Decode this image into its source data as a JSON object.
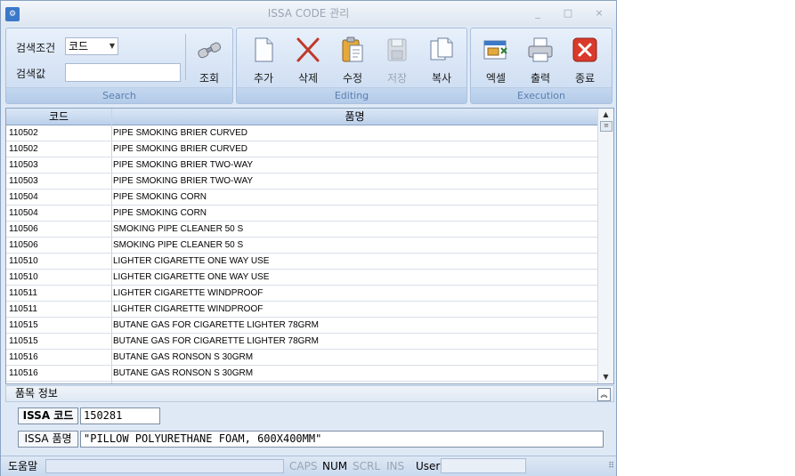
{
  "window": {
    "title": "ISSA CODE 관리",
    "minimize": "_",
    "maximize": "□",
    "close": "×"
  },
  "ribbon": {
    "search": {
      "group_label": "Search",
      "criteria_label": "검색조건",
      "criteria_value": "코드",
      "value_label": "검색값",
      "value_input": "",
      "query_label": "조회"
    },
    "editing": {
      "group_label": "Editing",
      "add_label": "추가",
      "delete_label": "삭제",
      "edit_label": "수정",
      "save_label": "저장",
      "copy_label": "복사"
    },
    "execution": {
      "group_label": "Execution",
      "excel_label": "엑셀",
      "print_label": "출력",
      "exit_label": "종료"
    }
  },
  "grid": {
    "columns": [
      "코드",
      "품명"
    ],
    "rows": [
      [
        "110502",
        "PIPE SMOKING BRIER CURVED"
      ],
      [
        "110502",
        "PIPE SMOKING BRIER CURVED"
      ],
      [
        "110503",
        "PIPE SMOKING BRIER TWO-WAY"
      ],
      [
        "110503",
        "PIPE SMOKING BRIER TWO-WAY"
      ],
      [
        "110504",
        "PIPE SMOKING CORN"
      ],
      [
        "110504",
        "PIPE SMOKING CORN"
      ],
      [
        "110506",
        "SMOKING PIPE CLEANER 50 S"
      ],
      [
        "110506",
        "SMOKING PIPE CLEANER 50 S"
      ],
      [
        "110510",
        "LIGHTER CIGARETTE ONE WAY USE"
      ],
      [
        "110510",
        "LIGHTER CIGARETTE ONE WAY USE"
      ],
      [
        "110511",
        "LIGHTER CIGARETTE WINDPROOF"
      ],
      [
        "110511",
        "LIGHTER CIGARETTE WINDPROOF"
      ],
      [
        "110515",
        "BUTANE GAS FOR CIGARETTE LIGHTER 78GRM"
      ],
      [
        "110515",
        "BUTANE GAS FOR CIGARETTE LIGHTER 78GRM"
      ],
      [
        "110516",
        "BUTANE GAS RONSON S 30GRM"
      ],
      [
        "110516",
        "BUTANE GAS RONSON S 30GRM"
      ]
    ]
  },
  "info": {
    "title": "품목 정보",
    "code_label": "ISSA 코드",
    "code_value": "150281",
    "name_label": "ISSA 품명",
    "name_value": "\"PILLOW POLYURETHANE FOAM, 600X400MM\""
  },
  "status": {
    "help": "도움말",
    "caps": "CAPS",
    "num": "NUM",
    "scrl": "SCRL",
    "ins": "INS",
    "user_label": "User",
    "user_value": ""
  },
  "colors": {
    "accent": "#3c78c8",
    "ribbon_label": "#5a7fb0",
    "delete_red": "#c0392b",
    "exit_red": "#d93a2b"
  }
}
